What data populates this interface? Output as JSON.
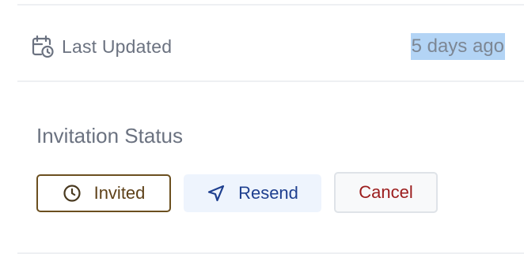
{
  "last_updated": {
    "label": "Last Updated",
    "value": "5 days ago",
    "icon": "calendar-clock-icon"
  },
  "invitation": {
    "title": "Invitation Status",
    "status_button": {
      "label": "Invited",
      "icon": "clock-icon",
      "color": "#5e4119"
    },
    "resend_button": {
      "label": "Resend",
      "icon": "send-icon",
      "color": "#1e3f8f"
    },
    "cancel_button": {
      "label": "Cancel",
      "color": "#9b1c1c"
    }
  }
}
